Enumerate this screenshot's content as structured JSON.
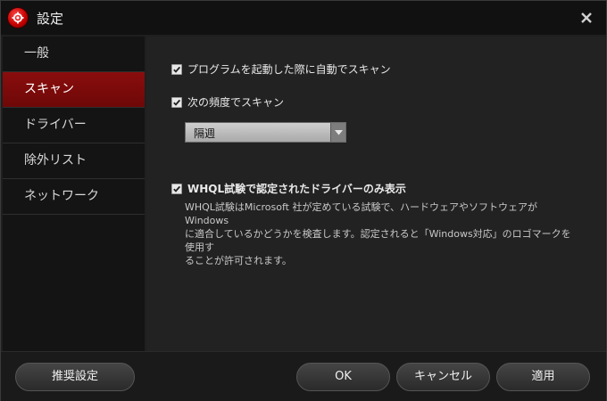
{
  "window": {
    "title": "設定",
    "close_glyph": "✕"
  },
  "sidebar": {
    "items": [
      {
        "label": "一般",
        "active": false
      },
      {
        "label": "スキャン",
        "active": true
      },
      {
        "label": "ドライバー",
        "active": false
      },
      {
        "label": "除外リスト",
        "active": false
      },
      {
        "label": "ネットワーク",
        "active": false
      }
    ]
  },
  "scan": {
    "startup_scan": {
      "label": "プログラムを起動した際に自動でスキャン",
      "checked": true
    },
    "scheduled_scan": {
      "label": "次の頻度でスキャン",
      "checked": true
    },
    "frequency": {
      "selected": "隔週"
    },
    "whql": {
      "label": "WHQL試験で認定されたドライバーのみ表示",
      "checked": true,
      "description_lines": [
        "WHQL試験はMicrosoft 社が定めている試験で、ハードウェアやソフトウェアがWindows",
        "に適合しているかどうかを検査します。認定されると「Windows対応」のロゴマークを使用す",
        "ることが許可されます。"
      ]
    }
  },
  "footer": {
    "recommended_label": "推奨設定",
    "ok_label": "OK",
    "cancel_label": "キャンセル",
    "apply_label": "適用"
  },
  "colors": {
    "accent": "#7a0a0a",
    "background": "#222222",
    "sidebar": "#141414"
  },
  "icons": {
    "app_logo": "gear-logo-icon",
    "close": "close-icon",
    "checkbox": "checkmark-icon",
    "dropdown": "chevron-down-icon"
  }
}
